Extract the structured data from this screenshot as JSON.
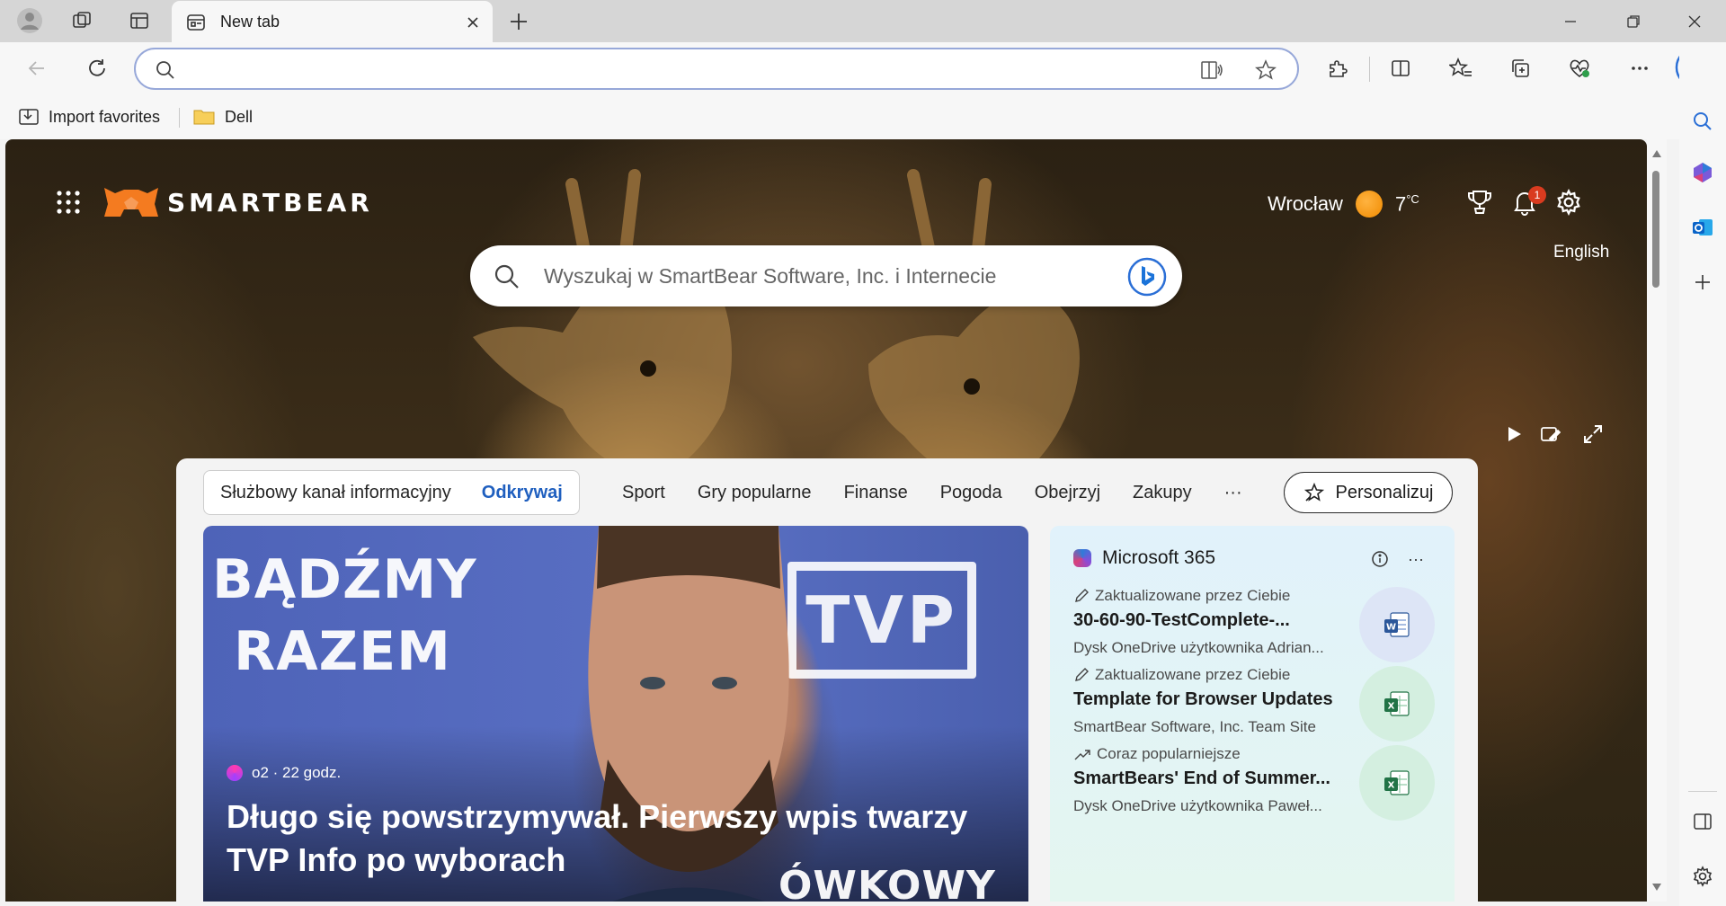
{
  "browser": {
    "tab": {
      "title": "New tab"
    },
    "new_tab_label": "+",
    "address": {
      "value": "",
      "placeholder": ""
    },
    "favorites": [
      {
        "label": "Import favorites"
      },
      {
        "label": "Dell"
      }
    ]
  },
  "newtab": {
    "brand": "SMARTBEAR",
    "weather": {
      "city": "Wrocław",
      "temp": "7",
      "unit": "°C"
    },
    "notifications_count": "1",
    "language": "English",
    "search_placeholder": "Wyszukaj w SmartBear Software, Inc. i Internecie",
    "feed": {
      "primary_tabs": [
        {
          "label": "Służbowy kanał informacyjny",
          "active": false
        },
        {
          "label": "Odkrywaj",
          "active": true
        }
      ],
      "tabs": [
        "Sport",
        "Gry popularne",
        "Finanse",
        "Pogoda",
        "Obejrzyj",
        "Zakupy",
        "···"
      ],
      "personalize_label": "Personalizuj"
    },
    "hero": {
      "overlay_line1": "BĄDŹMY",
      "overlay_line2": "RAZEM",
      "overlay_logo": "TVP",
      "overlay_bottom": "ÓWKOWY",
      "source": "o2 · 22 godz.",
      "title": "Długo się powstrzymywał. Pierwszy wpis twarzy TVP Info po wyborach"
    },
    "m365": {
      "title": "Microsoft 365",
      "more": "···",
      "items": [
        {
          "status": "Zaktualizowane przez Ciebie",
          "name": "30-60-90-TestComplete-...",
          "location": "Dysk OneDrive użytkownika Adrian...",
          "type": "word"
        },
        {
          "status": "Zaktualizowane przez Ciebie",
          "name": "Template for Browser Updates",
          "location": "SmartBear Software, Inc. Team Site",
          "type": "excel"
        },
        {
          "status": "Coraz popularniejsze",
          "name": "SmartBears' End of Summer...",
          "location": "Dysk OneDrive użytkownika Paweł...",
          "type": "excel"
        }
      ]
    }
  },
  "colors": {
    "accent": "#1f5fbf",
    "address_border": "#97a8d9",
    "badge": "#d93b1f",
    "logo_orange": "#f47b20"
  }
}
